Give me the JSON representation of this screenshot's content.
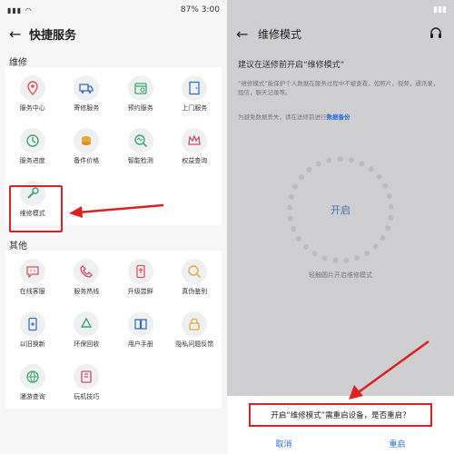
{
  "left": {
    "status": {
      "time": "3:00",
      "battery": "87%"
    },
    "title": "快捷服务",
    "section1": "维修",
    "repair_items": [
      {
        "label": "服务中心",
        "icon": "location-pin-icon"
      },
      {
        "label": "寄修服务",
        "icon": "truck-icon"
      },
      {
        "label": "预约服务",
        "icon": "calendar-icon"
      },
      {
        "label": "上门服务",
        "icon": "door-icon"
      },
      {
        "label": "服务进度",
        "icon": "progress-icon"
      },
      {
        "label": "备件价格",
        "icon": "coins-icon"
      },
      {
        "label": "智能检测",
        "icon": "detect-icon"
      },
      {
        "label": "权益查询",
        "icon": "crown-icon"
      },
      {
        "label": "维修模式",
        "icon": "repair-mode-icon"
      }
    ],
    "section2": "其他",
    "other_items": [
      {
        "label": "在线客服",
        "icon": "chat-icon"
      },
      {
        "label": "服务热线",
        "icon": "phone-icon"
      },
      {
        "label": "升级尝鲜",
        "icon": "upgrade-icon"
      },
      {
        "label": "真伪鉴别",
        "icon": "verify-icon"
      },
      {
        "label": "以旧换新",
        "icon": "trade-in-icon"
      },
      {
        "label": "环保回收",
        "icon": "recycle-icon"
      },
      {
        "label": "用户手册",
        "icon": "book-icon"
      },
      {
        "label": "隐私问题反馈",
        "icon": "lock-icon"
      },
      {
        "label": "漫游查询",
        "icon": "roaming-icon"
      },
      {
        "label": "玩机技巧",
        "icon": "tips-icon"
      }
    ]
  },
  "right": {
    "title": "维修模式",
    "advice": "建议在送修前开启“维修模式”",
    "description": "“维修模式”能保护个人数据在服务过程中不被查看，如照片，视频，通讯录，短信，聊天记录等。",
    "backup_text": "为避免数据丢失，请在送修前进行",
    "backup_link": "数据备份",
    "open_label": "开启",
    "hint": "轻触圆片开启维修模式",
    "dialog_message": "开启“维修模式”需重启设备，是否重启？",
    "cancel": "取消",
    "restart": "重启"
  },
  "colors": {
    "accent": "#2a6fd6",
    "highlight": "#e02020"
  }
}
